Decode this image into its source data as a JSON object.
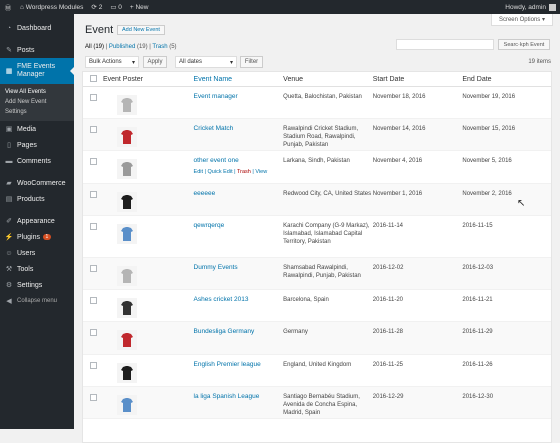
{
  "adminbar": {
    "site": "Wordpress Modules",
    "updates": "2",
    "comments": "0",
    "new": "+ New",
    "howdy": "Howdy, admin"
  },
  "sidebar": {
    "dashboard": "Dashboard",
    "posts": "Posts",
    "current": "FME Events Manager",
    "sub": [
      "View All Events",
      "Add New Event",
      "Settings"
    ],
    "media": "Media",
    "pages": "Pages",
    "comments": "Comments",
    "woocommerce": "WooCommerce",
    "products": "Products",
    "appearance": "Appearance",
    "plugins": "Plugins",
    "plugins_badge": "1",
    "users": "Users",
    "tools": "Tools",
    "settings": "Settings",
    "collapse": "Collapse menu"
  },
  "screen_options": "Screen Options ▾",
  "page_title": "Event",
  "add_new": "Add New Event",
  "views": {
    "all": "All",
    "all_count": "(19)",
    "published": "Published",
    "published_count": "(19)",
    "trash": "Trash",
    "trash_count": "(5)"
  },
  "search_button": "Searc·kph Event",
  "bulk": "Bulk Actions",
  "apply": "Apply",
  "dates": "All dates",
  "filter": "Filter",
  "items": "19 items",
  "columns": {
    "poster": "Event Poster",
    "name": "Event Name",
    "venue": "Venue",
    "start": "Start Date",
    "end": "End Date"
  },
  "row_actions": {
    "edit": "Edit",
    "quick": "Quick Edit",
    "trash": "Trash",
    "view": "View"
  },
  "rows": [
    {
      "name": "Event manager",
      "venue": "Quetta, Balochistan, Pakistan",
      "start": "November 18, 2016",
      "end": "November 19, 2016",
      "poster": "gray"
    },
    {
      "name": "Cricket Match",
      "venue": "Rawalpindi Cricket Stadium, Stadium Road, Rawalpindi, Punjab, Pakistan",
      "start": "November 14, 2016",
      "end": "November 15, 2016",
      "poster": "red"
    },
    {
      "name": "other event one",
      "venue": "Larkana, Sindh, Pakistan",
      "start": "November 4, 2016",
      "end": "November 5, 2016",
      "poster": "white"
    },
    {
      "name": "eeeeee",
      "venue": "Redwood City, CA, United States",
      "start": "November 1, 2016",
      "end": "November 2, 2016",
      "poster": "black"
    },
    {
      "name": "qewrqerqe",
      "venue": "Karachi Company (G-9 Markaz), Islamabad, Islamabad Capital Territory, Pakistan",
      "start": "2016-11-14",
      "end": "2016-11-15",
      "poster": "blue"
    },
    {
      "name": "Dummy Events",
      "venue": "Shamsabad Rawalpindi, Rawalpindi, Punjab, Pakistan",
      "start": "2016-12-02",
      "end": "2016-12-03",
      "poster": "gray"
    },
    {
      "name": "Ashes cricket 2013",
      "venue": "Barcelona, Spain",
      "start": "2016-11-20",
      "end": "2016-11-21",
      "poster": "dark"
    },
    {
      "name": "Bundesliga Germany",
      "venue": "Germany",
      "start": "2016-11-28",
      "end": "2016-11-29",
      "poster": "red"
    },
    {
      "name": "English Premier league",
      "venue": "England, United Kingdom",
      "start": "2016-11-25",
      "end": "2016-11-26",
      "poster": "black"
    },
    {
      "name": "la liga Spanish League",
      "venue": "Santiago Bernabéu Stadium, Avenida de Concha Espina, Madrid, Spain",
      "start": "2016-12-29",
      "end": "2016-12-30",
      "poster": "blue"
    }
  ],
  "poster_colors": {
    "gray": "#b5b5b5",
    "red": "#c0282d",
    "white": "#9a9a9a",
    "black": "#1d1d1d",
    "blue": "#5a8fc9",
    "dark": "#333333"
  }
}
